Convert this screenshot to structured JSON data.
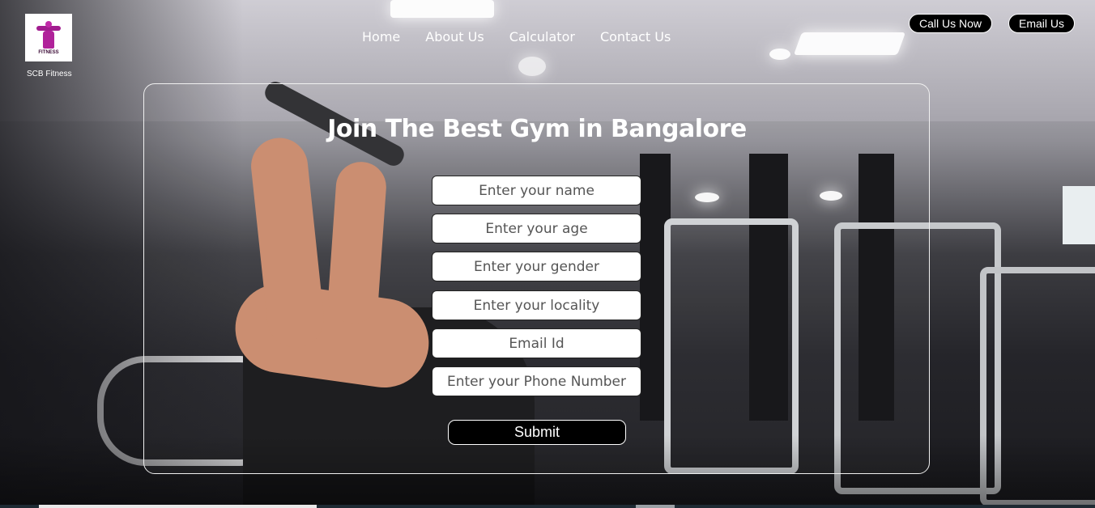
{
  "header": {
    "brand_name": "SCB Fitness",
    "logo_text": "FITNESS",
    "logo_icon": "fitness-logo-icon",
    "nav": [
      {
        "label": "Home"
      },
      {
        "label": "About Us"
      },
      {
        "label": "Calculator"
      },
      {
        "label": "Contact Us"
      }
    ],
    "call_button": "Call Us Now",
    "email_button": "Email Us"
  },
  "form": {
    "heading": "Join The Best Gym in Bangalore",
    "fields": [
      {
        "name": "name",
        "placeholder": "Enter your name",
        "value": ""
      },
      {
        "name": "age",
        "placeholder": "Enter your age",
        "value": ""
      },
      {
        "name": "gender",
        "placeholder": "Enter your gender",
        "value": ""
      },
      {
        "name": "locality",
        "placeholder": "Enter your locality",
        "value": ""
      },
      {
        "name": "email",
        "placeholder": "Email Id",
        "value": ""
      },
      {
        "name": "phone",
        "placeholder": "Enter your Phone Number",
        "value": ""
      }
    ],
    "submit_label": "Submit"
  },
  "colors": {
    "logo_accent": "#b0229a",
    "button_bg": "#000000",
    "text": "#ffffff"
  }
}
